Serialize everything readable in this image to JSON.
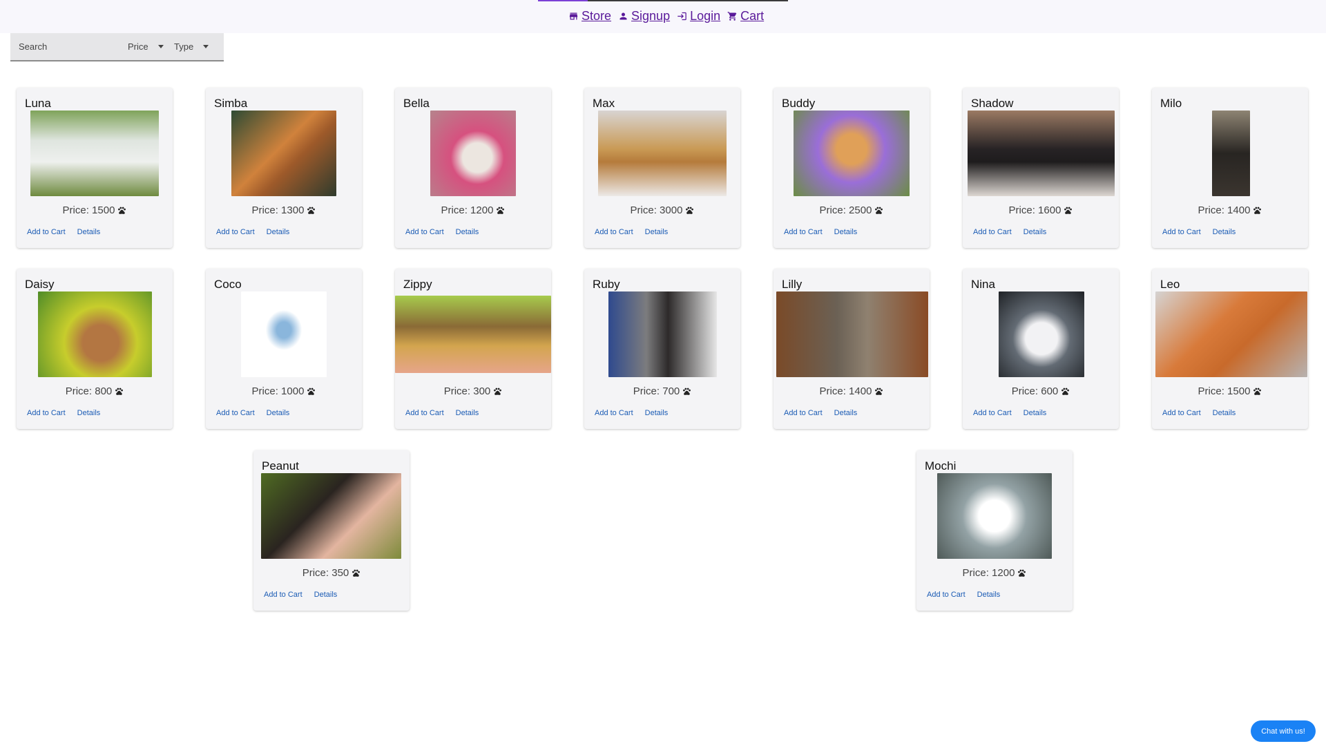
{
  "nav": {
    "items": [
      {
        "label": "Store",
        "icon": "store-icon"
      },
      {
        "label": "Signup",
        "icon": "person-icon"
      },
      {
        "label": "Login",
        "icon": "login-icon"
      },
      {
        "label": "Cart",
        "icon": "cart-icon"
      }
    ]
  },
  "filters": {
    "search_placeholder": "Search",
    "price_label": "Price",
    "type_label": "Type"
  },
  "pets": [
    {
      "name": "Luna",
      "price": "Price: 1500"
    },
    {
      "name": "Simba",
      "price": "Price: 1300"
    },
    {
      "name": "Bella",
      "price": "Price: 1200"
    },
    {
      "name": "Max",
      "price": "Price: 3000"
    },
    {
      "name": "Buddy",
      "price": "Price: 2500"
    },
    {
      "name": "Shadow",
      "price": "Price: 1600"
    },
    {
      "name": "Milo",
      "price": "Price: 1400"
    },
    {
      "name": "Daisy",
      "price": "Price: 800"
    },
    {
      "name": "Coco",
      "price": "Price: 1000"
    },
    {
      "name": "Zippy",
      "price": "Price: 300"
    },
    {
      "name": "Ruby",
      "price": "Price: 700"
    },
    {
      "name": "Lilly",
      "price": "Price: 1400"
    },
    {
      "name": "Nina",
      "price": "Price: 600"
    },
    {
      "name": "Leo",
      "price": "Price: 1500"
    },
    {
      "name": "Peanut",
      "price": "Price: 350"
    },
    {
      "name": "Mochi",
      "price": "Price: 1200"
    }
  ],
  "card_actions": {
    "add_to_cart": "Add to Cart",
    "details": "Details"
  },
  "price_icon": "paw-icon",
  "chat_label": "Chat with us!",
  "colors": {
    "nav_link": "#5a1a9a",
    "action_link": "#1a5bb4",
    "chat_button": "#1a82f5",
    "active_tab": "#7b3fd6"
  }
}
